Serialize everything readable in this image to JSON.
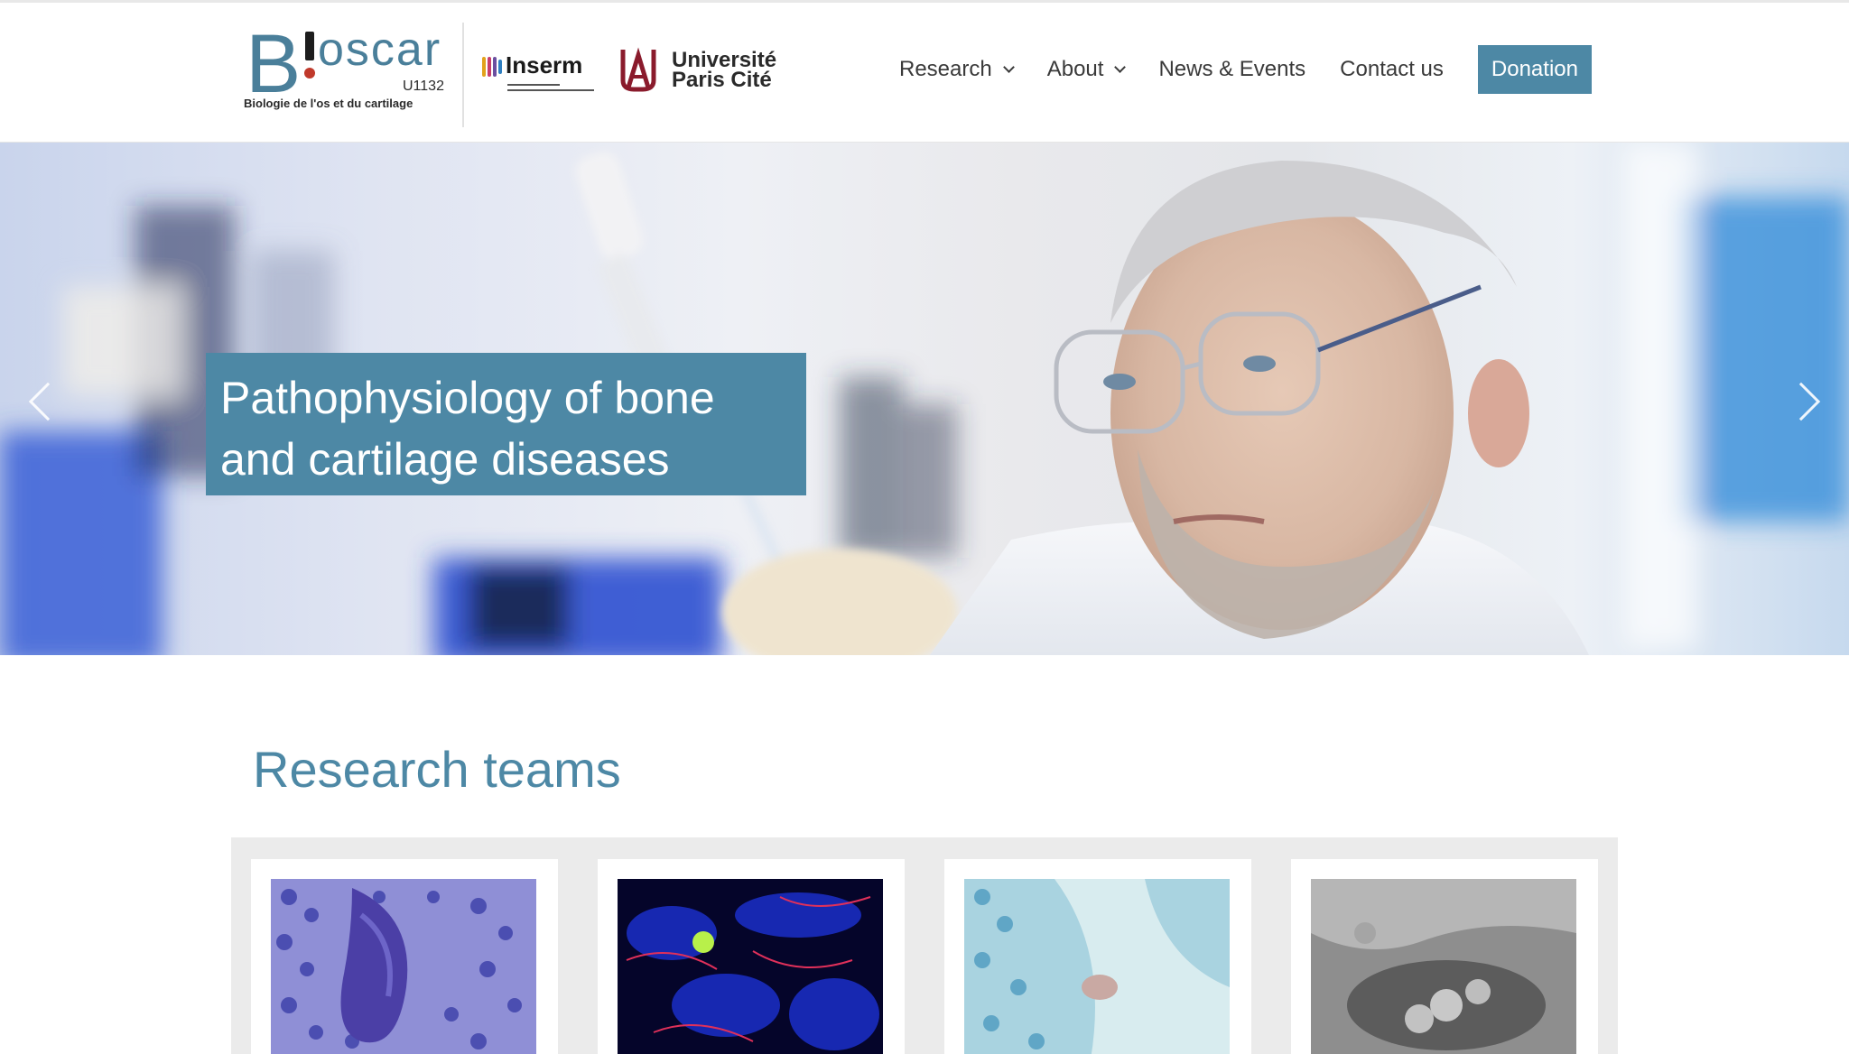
{
  "logos": {
    "bioscar": {
      "letter": "B",
      "name": "oscar",
      "unit": "U1132",
      "subtitle": "Biologie de l'os et du cartilage"
    },
    "inserm": {
      "name": "Inserm"
    },
    "universite": {
      "line1": "Université",
      "line2": "Paris Cité"
    }
  },
  "nav": {
    "items": [
      {
        "label": "Research",
        "has_dropdown": true
      },
      {
        "label": "About",
        "has_dropdown": true
      },
      {
        "label": "News & Events",
        "has_dropdown": false
      },
      {
        "label": "Contact us",
        "has_dropdown": false
      }
    ],
    "donate_label": "Donation"
  },
  "hero": {
    "caption": "Pathophysiology of bone\nand cartilage diseases",
    "prev_icon": "chevron-left-icon",
    "next_icon": "chevron-right-icon"
  },
  "research": {
    "title": "Research teams"
  },
  "colors": {
    "accent": "#4d88a5",
    "text": "#3a3a3a"
  }
}
